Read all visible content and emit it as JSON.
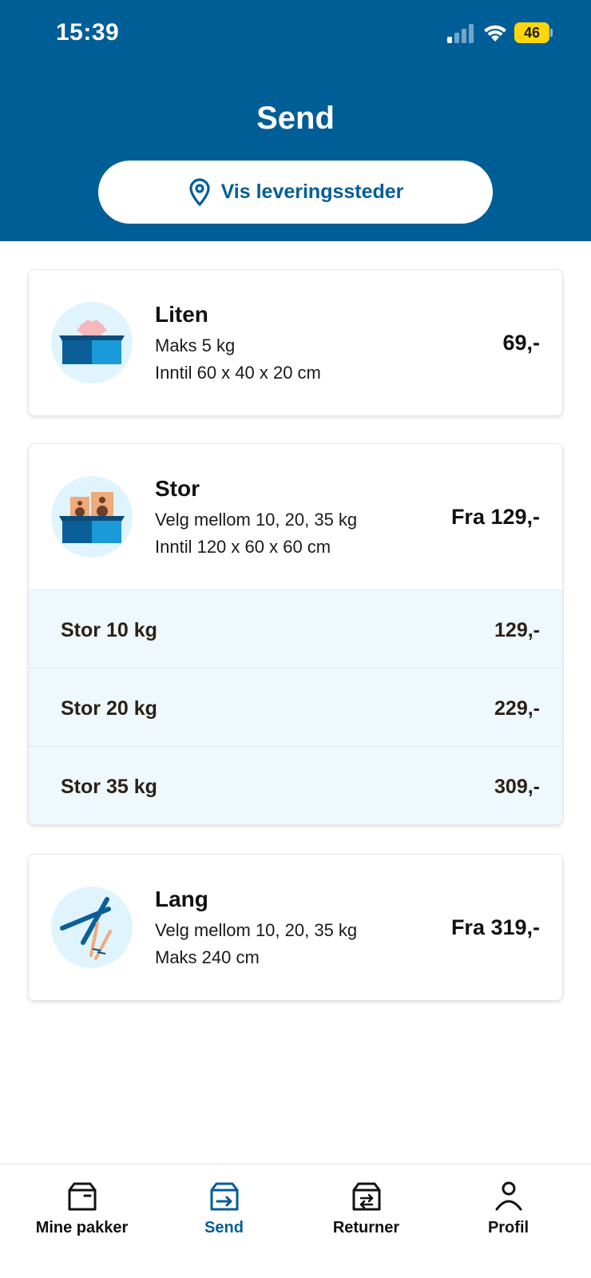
{
  "status_bar": {
    "time": "15:39",
    "battery": "46"
  },
  "header": {
    "title": "Send",
    "locations_button": "Vis leveringssteder"
  },
  "cards": {
    "small": {
      "title": "Liten",
      "line1": "Maks 5 kg",
      "line2": "Inntil 60 x 40 x 20 cm",
      "price": "69,-",
      "icon": "box-with-shirt-icon"
    },
    "large": {
      "title": "Stor",
      "line1": "Velg mellom 10, 20, 35 kg",
      "line2": "Inntil 120 x 60 x 60 cm",
      "price": "Fra 129,-",
      "icon": "box-with-speakers-icon",
      "options": [
        {
          "label": "Stor 10 kg",
          "price": "129,-"
        },
        {
          "label": "Stor 20 kg",
          "price": "229,-"
        },
        {
          "label": "Stor 35 kg",
          "price": "309,-"
        }
      ]
    },
    "long": {
      "title": "Lang",
      "line1": "Velg mellom 10, 20, 35 kg",
      "line2": "Maks 240 cm",
      "price": "Fra 319,-",
      "icon": "skis-and-poles-icon"
    }
  },
  "tabbar": {
    "tabs": [
      {
        "label": "Mine pakker",
        "icon": "package-icon"
      },
      {
        "label": "Send",
        "icon": "send-package-icon",
        "active": true
      },
      {
        "label": "Returner",
        "icon": "return-package-icon"
      },
      {
        "label": "Profil",
        "icon": "person-icon"
      }
    ]
  },
  "colors": {
    "brand": "#005e97",
    "option_bg": "#eff9fd",
    "icon_bg": "#dff4fc"
  }
}
